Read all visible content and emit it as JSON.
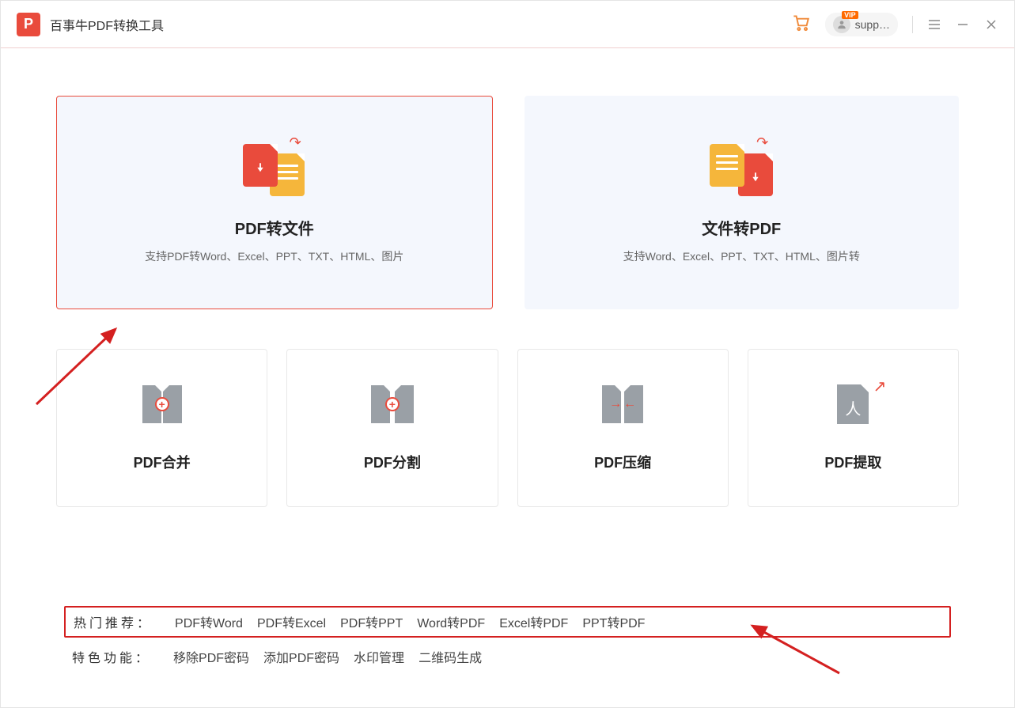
{
  "app": {
    "logo_letter": "P",
    "title": "百事牛PDF转换工具",
    "user_label": "supp…",
    "vip": "VIP"
  },
  "cards": {
    "pdf_to_file": {
      "title": "PDF转文件",
      "subtitle": "支持PDF转Word、Excel、PPT、TXT、HTML、图片"
    },
    "file_to_pdf": {
      "title": "文件转PDF",
      "subtitle": "支持Word、Excel、PPT、TXT、HTML、图片转"
    },
    "merge": {
      "title": "PDF合并"
    },
    "split": {
      "title": "PDF分割"
    },
    "compress": {
      "title": "PDF压缩"
    },
    "extract": {
      "title": "PDF提取"
    }
  },
  "footer": {
    "hot_label": "热门推荐：",
    "hot_items": [
      "PDF转Word",
      "PDF转Excel",
      "PDF转PPT",
      "Word转PDF",
      "Excel转PDF",
      "PPT转PDF"
    ],
    "feat_label": "特色功能：",
    "feat_items": [
      "移除PDF密码",
      "添加PDF密码",
      "水印管理",
      "二维码生成"
    ]
  }
}
